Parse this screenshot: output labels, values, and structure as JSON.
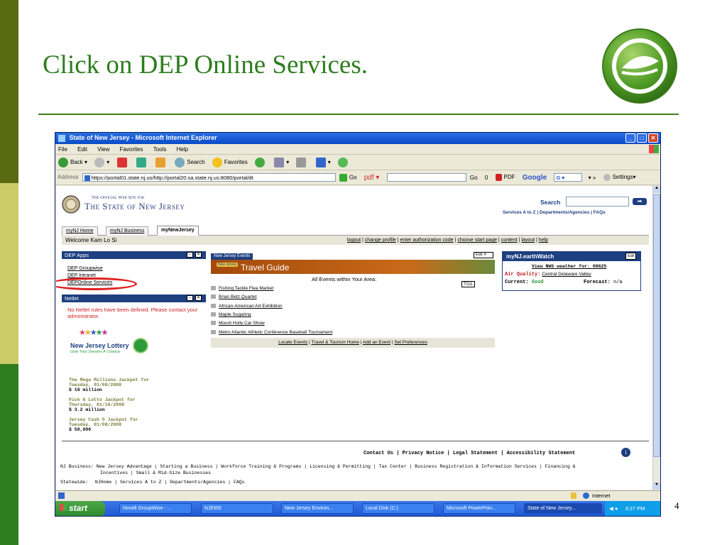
{
  "slide": {
    "title": "Click on DEP Online Services.",
    "page_number": "4",
    "colors": {
      "accent_green": "#2e7d1e",
      "rule": "#3f7f1d",
      "bar_dark": "#5a6a10",
      "bar_light": "#cccc66",
      "bar_green": "#2e7d1e"
    },
    "logo_icon": "leaf-globe-icon"
  },
  "browser": {
    "title": "State of New Jersey - Microsoft Internet Explorer",
    "menu": [
      "File",
      "Edit",
      "View",
      "Favorites",
      "Tools",
      "Help"
    ],
    "toolbar": {
      "back": "Back",
      "search": "Search",
      "favorites": "Favorites"
    },
    "address": {
      "label": "Address",
      "url": "https://portal01.state.nj.us/http://portal20.sa.state.nj.us:8080/portal/dt",
      "go": "Go"
    },
    "pdf_toolbar": {
      "pdf": "pdf",
      "go": "Go",
      "zero": "0",
      "pdf_label": "PDF",
      "google": "Google",
      "g": "G",
      "settings": "Settings"
    },
    "status": {
      "zone": "Internet"
    }
  },
  "portal": {
    "site_small": "The Official Web Site for",
    "site_name": "The State of New Jersey",
    "search_label": "Search",
    "top_links": "Services A to Z | Departments/Agencies | FAQs",
    "tabs": [
      "myNJ Home",
      "myNJ Business",
      "myNewJersey"
    ],
    "welcome": "Welcome Kam Lo Si",
    "user_links": [
      "logout",
      "change profile",
      "enter authorization code",
      "choose start page",
      "content",
      "layout",
      "help"
    ],
    "dep_apps": {
      "title": "DEP Apps",
      "links": [
        "DEP Groupwise",
        "DEP Intranet",
        "DEPOnline Services"
      ]
    },
    "netlet": {
      "title": "Netlet",
      "message": "No Netlet rules have been defined. Please contact your administrator."
    },
    "lottery": {
      "brand": "New Jersey Lottery",
      "tagline": "Give Your Dreams A Chance",
      "items": [
        {
          "line1": "The Mega Millions Jackpot for",
          "line2": "Tuesday, 01/08/2008",
          "amount": "$ 16 million"
        },
        {
          "line1": "Pick 6 Lotto Jackpot for",
          "line2": "Thursday, 01/10/2008",
          "amount": "$ 3.2 million"
        },
        {
          "line1": "Jersey Cash 5 Jackpot for",
          "line2": "Tuesday, 01/08/2008",
          "amount": "$ 50,000"
        }
      ]
    },
    "events": {
      "tab": "New Jersey Events",
      "banner_badge": "New Jersey",
      "banner": "Travel Guide",
      "edit": "Edit",
      "subtitle": "All Events within Your Area:",
      "tg_label": "TG1",
      "items": [
        "Fishing Tackle Flea Market",
        "Brian Betz Quartet",
        "African-American Art Exhibition",
        "Maple Sugaring",
        "Mount Holly Car Show",
        "Metro Atlantic Athletic Conference Baseball Tournament"
      ],
      "footer": [
        "Locate Events",
        "Travel & Tourism Home",
        "Add an Event",
        "Set Preferences"
      ]
    },
    "earthwatch": {
      "title": "myNJ.earthWatch",
      "edit": "Edit",
      "weather_link": "View NWS weather for: 08625",
      "air_label": "Air Quality:",
      "air_value": "Central Delaware Valley",
      "current_label": "Current:",
      "current_value": "Good",
      "forecast_label": "Forecast:",
      "forecast_value": "n/a"
    },
    "footer": {
      "links": "Contact Us | Privacy Notice | Legal Statement | Accessibility Statement",
      "business_label": "NJ Business:",
      "business_links": "New Jersey Advantage | Starting a Business | Workforce Training & Programs | Licensing & Permitting | Tax Center | Business Registration & Information Services | Financing &",
      "business_links2": "Incentives | Small & Mid-Size Businesses",
      "statewide_label": "Statewide:",
      "statewide_links": "NJHome | Services A to Z | Departments/Agencies | FAQs"
    }
  },
  "taskbar": {
    "start": "start",
    "tasks": [
      "Novell GroupWise - ...",
      "NJEMS",
      "New Jersey Environ...",
      "Local Disk (C:)",
      "Microsoft PowerPoin...",
      "State of New Jersey..."
    ],
    "clock": "3:27 PM"
  }
}
